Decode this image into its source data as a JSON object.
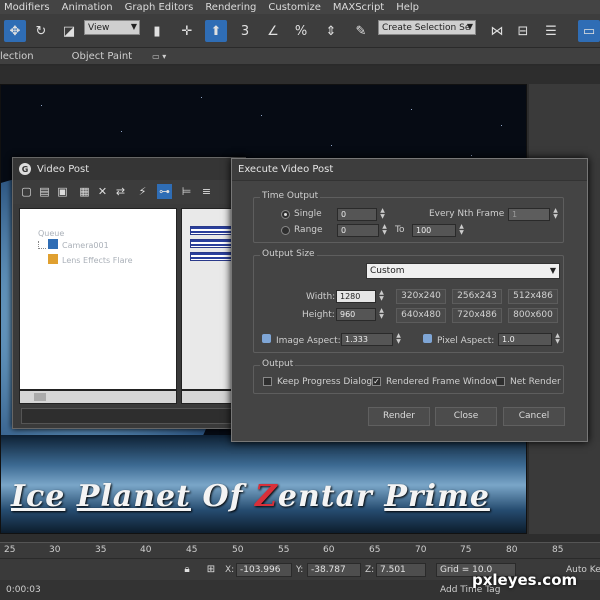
{
  "menu": [
    "Modifiers",
    "Animation",
    "Graph Editors",
    "Rendering",
    "Customize",
    "MAXScript",
    "Help"
  ],
  "toolbar": {
    "view_combo": "View",
    "selection_combo": "Create Selection Se"
  },
  "ribbon": {
    "selection_label": "lection",
    "object_paint_label": "Object Paint"
  },
  "viewport": {
    "title_part1": "Ice",
    "title_part2": "Planet",
    "title_part3": "Of",
    "title_z": "Z",
    "title_rest": "entar",
    "title_part5": "Prime"
  },
  "video_post": {
    "title": "Video Post",
    "queue_label": "Queue",
    "items": [
      "Camera001",
      "Lens Effects Flare"
    ]
  },
  "execute_dialog": {
    "title": "Execute Video Post",
    "time_output": {
      "label": "Time Output",
      "single_label": "Single",
      "single_value": "0",
      "range_label": "Range",
      "range_from": "0",
      "to_label": "To",
      "range_to": "100",
      "every_nth_label": "Every Nth Frame",
      "every_nth_value": "1"
    },
    "output_size": {
      "label": "Output Size",
      "preset_selected": "Custom",
      "width_label": "Width:",
      "width_value": "1280",
      "height_label": "Height:",
      "height_value": "960",
      "presets": [
        "320x240",
        "256x243",
        "512x486",
        "640x480",
        "720x486",
        "800x600"
      ],
      "image_aspect_label": "Image Aspect:",
      "image_aspect_value": "1.333",
      "pixel_aspect_label": "Pixel Aspect:",
      "pixel_aspect_value": "1.0"
    },
    "output": {
      "label": "Output",
      "keep_progress_label": "Keep Progress Dialog",
      "keep_progress_checked": false,
      "rendered_frame_label": "Rendered Frame Window",
      "rendered_frame_checked": true,
      "net_render_label": "Net Render",
      "net_render_checked": false
    },
    "buttons": {
      "render": "Render",
      "close": "Close",
      "cancel": "Cancel"
    }
  },
  "timeline": {
    "ticks": [
      "25",
      "30",
      "35",
      "40",
      "45",
      "50",
      "55",
      "60",
      "65",
      "70",
      "75",
      "80",
      "85"
    ]
  },
  "coords": {
    "x_label": "X:",
    "x_value": "-103.996",
    "y_label": "Y:",
    "y_value": "-38.787",
    "z_label": "Z:",
    "z_value": "7.501",
    "grid_label": "Grid = 10.0",
    "auto_key_label": "Auto Key",
    "add_time_tag_label": "Add Time Tag",
    "time_label": "0:00:03"
  },
  "watermark": "pxleyes.com",
  "colors": {
    "accent": "#2f6db5",
    "title_red": "#d8303a"
  }
}
